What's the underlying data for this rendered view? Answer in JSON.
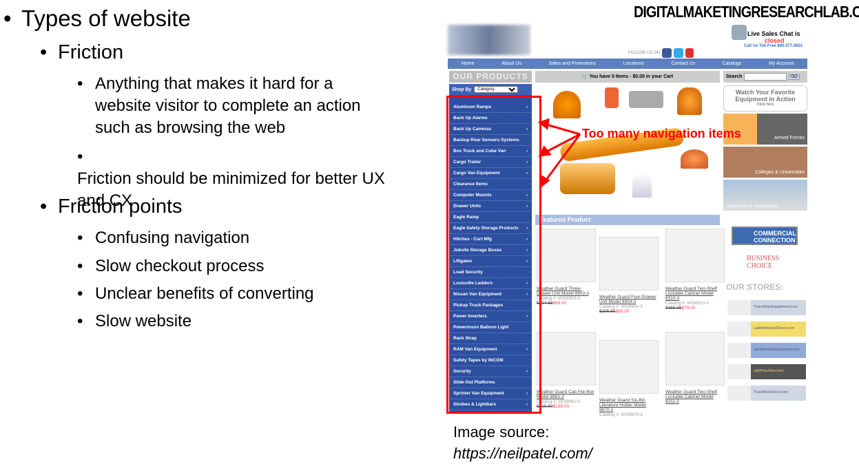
{
  "slide": {
    "bullets": [
      {
        "text": "Types of website",
        "children": [
          {
            "text": "Friction",
            "children": [
              {
                "text": "Anything that makes it hard for a website visitor to complete an action such as browsing the web"
              },
              {
                "text": "Friction should be minimized for better UX and CX"
              }
            ]
          },
          {
            "text": "Friction points",
            "children": [
              {
                "text": "Confusing navigation"
              },
              {
                "text": "Slow checkout process"
              },
              {
                "text": "Unclear benefits of converting"
              },
              {
                "text": "Slow website"
              }
            ]
          }
        ]
      }
    ],
    "logo": "DIGITALMAKETINGRESEARCHLAB.COM",
    "caption": {
      "line1": "Image source:",
      "line2": "https://neilpatel.com/"
    }
  },
  "screenshot": {
    "follow": "FOLLOW US ON",
    "chat": {
      "line1": "Live Sales Chat is",
      "status": "closed",
      "phone": "Call Us Toll Free 800.377.5652"
    },
    "nav": [
      "Home",
      "About Us",
      "Sales and Promotions",
      "Locations",
      "Contact Us",
      "Catalogs",
      "My Account"
    ],
    "products_header": "OUR PRODUCTS",
    "cart": "You have 0 Items - $0.00 in your Cart",
    "search_label": "Search",
    "go": "GO",
    "shop_by": "Shop By",
    "category": "Category",
    "categories": [
      {
        "l": "Aluminum Ramps",
        "s": true
      },
      {
        "l": "Back Up Alarms",
        "s": false
      },
      {
        "l": "Back Up Cameras",
        "s": true
      },
      {
        "l": "Backup Rear Sensors Systems",
        "s": false
      },
      {
        "l": "Box Truck and Cube Van",
        "s": true
      },
      {
        "l": "Cargo Trailer",
        "s": true
      },
      {
        "l": "Cargo Van Equipment",
        "s": true
      },
      {
        "l": "Clearance Items",
        "s": false
      },
      {
        "l": "Computer Mounts",
        "s": true
      },
      {
        "l": "Drawer Units",
        "s": true
      },
      {
        "l": "Eagle Ramp",
        "s": false
      },
      {
        "l": "Eagle Safety Storage Products",
        "s": true
      },
      {
        "l": "Hitches - Curt Mfg",
        "s": true
      },
      {
        "l": "Jobsite Storage Boxes",
        "s": true
      },
      {
        "l": "Liftgates",
        "s": true
      },
      {
        "l": "Load Security",
        "s": false
      },
      {
        "l": "Louisville Ladders",
        "s": true
      },
      {
        "l": "Nissan Van Equipment",
        "s": true
      },
      {
        "l": "Pickup Truck Packages",
        "s": false
      },
      {
        "l": "Power Inverters",
        "s": true
      },
      {
        "l": "Powermoon Balloon Light",
        "s": false
      },
      {
        "l": "Rack Strap",
        "s": false
      },
      {
        "l": "RAM Van Equipment",
        "s": true
      },
      {
        "l": "Safety Tapes by INCOM",
        "s": false
      },
      {
        "l": "Security",
        "s": true
      },
      {
        "l": "Slide-Out Platforms",
        "s": false
      },
      {
        "l": "Sprinter Van Equipment",
        "s": true
      },
      {
        "l": "Strobes & Lightbars",
        "s": true
      }
    ],
    "annotation": "Too many navigation items",
    "featured": "Featured Product",
    "products": [
      {
        "name": "Weather Guard Three-Drawer Unit Model 8903-3",
        "cat": "Catalog #: WG8903-3",
        "old": "$294.65",
        "new": "$89.00"
      },
      {
        "name": "Weather Guard Four-Drawer Unit Model 8904-3",
        "cat": "Catalog #: WG8904-3",
        "old": "$295.65",
        "new": "$89.00"
      },
      {
        "name": "Weather Guard Two-Shelf Lockable Cabinet Model 8310-3",
        "cat": "Catalog #: WG8310-3",
        "old": "$355.65",
        "new": "$79.00"
      },
      {
        "name": "Weather Guard Cab File Box Model 8861-3",
        "cat": "Catalog #: WG8861-3",
        "old": "$215.90",
        "new": "$139.00"
      },
      {
        "name": "Weather Guard Six-Bin Literature Holder Model 8870-3",
        "cat": "Catalog #: WG8870-3",
        "old": "",
        "new": ""
      },
      {
        "name": "Weather Guard Two-Shelf Lockable Cabinet Model 8311-3",
        "cat": "",
        "old": "",
        "new": ""
      }
    ],
    "ads": {
      "watch": "Watch Your Favorite Equipment in Action",
      "click": "Click Here",
      "armed": "Armed Forces",
      "colleges": "Colleges & Universities",
      "gov": "Government & Municipalities",
      "ford": "COMMERCIAL CONNECTION",
      "gm": "BUSINESS CHOICE",
      "stores": "OUR STORES:",
      "store_list": [
        "TransitVanEquipment.com",
        "LadderRacksDirect.com",
        "SprinterVanEquipment.com",
        "UpfitYourVan.com",
        "TruckBoxDirect.com"
      ]
    }
  }
}
